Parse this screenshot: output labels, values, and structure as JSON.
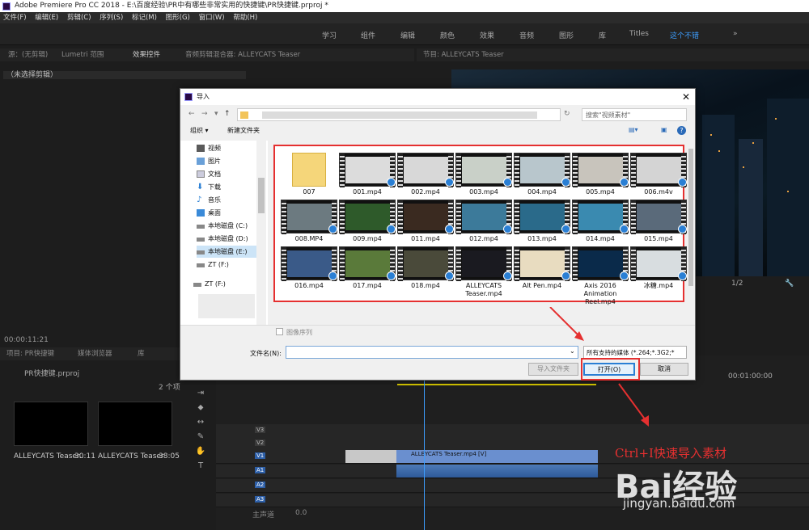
{
  "window": {
    "title": "Adobe Premiere Pro CC 2018 - E:\\百度经验\\PR中有哪些非常实用的快捷键\\PR快捷键.prproj *"
  },
  "menu": [
    "文件(F)",
    "编辑(E)",
    "剪辑(C)",
    "序列(S)",
    "标记(M)",
    "图形(G)",
    "窗口(W)",
    "帮助(H)"
  ],
  "workspaces": [
    "学习",
    "组件",
    "编辑",
    "颜色",
    "效果",
    "音频",
    "图形",
    "库",
    "Titles",
    "这个不错"
  ],
  "source_panel": {
    "tabs": [
      "源：(无剪辑)",
      "Lumetri 范围",
      "效果控件",
      "音频剪辑混合器: ALLEYCATS Teaser"
    ],
    "no_clip": "（未选择剪辑）",
    "timecode": "00:00:11:21"
  },
  "program_panel": {
    "title": "节目: ALLEYCATS Teaser",
    "zoom": "1/2"
  },
  "project_panel": {
    "tabs": [
      "项目: PR快捷键",
      "媒体浏览器",
      "库"
    ],
    "file": "PR快捷键.prproj",
    "count": "2 个项",
    "items": [
      {
        "name": "ALLEYCATS Teaser...",
        "duration": "30:11"
      },
      {
        "name": "ALLEYCATS Teaser",
        "duration": "38:05"
      }
    ]
  },
  "timeline": {
    "timecode": "00:01:00:00",
    "tracks": [
      "V3",
      "V2",
      "V1",
      "A1",
      "A2",
      "A3"
    ],
    "master": "主声道",
    "master_val": "0.0",
    "clip_video": "ALLEYCATS Teaser.mp4 [V]"
  },
  "dialog": {
    "title": "导入",
    "search_placeholder": "搜索\"视频素材\"",
    "organize": "组织 ▾",
    "new_folder": "新建文件夹",
    "sidebar": [
      "视频",
      "图片",
      "文档",
      "下载",
      "音乐",
      "桌面",
      "本地磁盘 (C:)",
      "本地磁盘 (D:)",
      "本地磁盘 (E:)",
      "ZT (F:)",
      "ZT (F:)"
    ],
    "files": [
      "007",
      "001.mp4",
      "002.mp4",
      "003.mp4",
      "004.mp4",
      "005.mp4",
      "006.m4v",
      "008.MP4",
      "009.mp4",
      "011.mp4",
      "012.mp4",
      "013.mp4",
      "014.mp4",
      "015.mp4",
      "016.mp4",
      "017.mp4",
      "018.mp4",
      "ALLEYCATS Teaser.mp4",
      "Alt Pen.mp4",
      "Axis 2016 Animation Reel.mp4",
      "冰糖.mp4"
    ],
    "image_sequence": "图像序列",
    "filename_label": "文件名(N):",
    "filename_value": "",
    "filetype": "所有支持的媒体 (*.264;*.3G2;*",
    "import_folder": "导入文件夹",
    "open": "打开(O)",
    "cancel": "取消"
  },
  "annotation": {
    "text": "Ctrl+I快速导入素材",
    "watermark": "Bai经验",
    "url": "jingyan.baidu.com"
  },
  "colors": {
    "accent": "#3d9eff",
    "highlight": "#e53030"
  }
}
